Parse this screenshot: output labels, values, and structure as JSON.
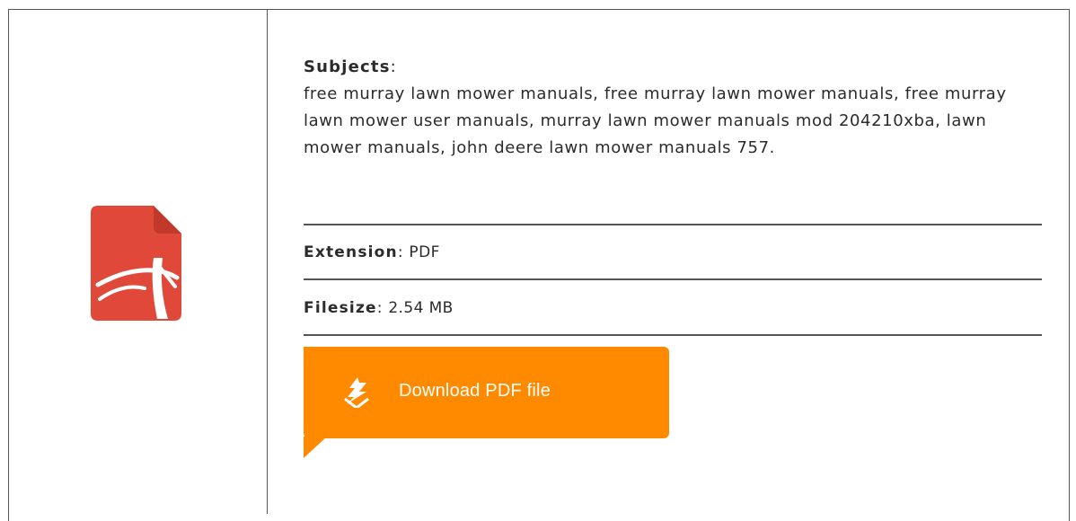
{
  "subjects": {
    "label": "Subjects",
    "colon": ":",
    "text": "free murray lawn mower manuals, free murray lawn mower manuals, free murray lawn mower user manuals, murray lawn mower manuals mod 204210xba, lawn mower manuals, john deere lawn mower manuals 757."
  },
  "extension": {
    "label": "Extension",
    "colon": ":",
    "value": "PDF"
  },
  "filesize": {
    "label": "Filesize",
    "colon": ":",
    "value": "2.54 MB"
  },
  "download": {
    "label": "Download PDF file",
    "icon": "download-arrow-icon",
    "color": "#ff8a00"
  },
  "file_icon": {
    "icon": "pdf-file-icon",
    "color": "#e0493a"
  },
  "colors": {
    "border": "#555555",
    "text": "#2b2b2b",
    "accent": "#ff8a00"
  }
}
